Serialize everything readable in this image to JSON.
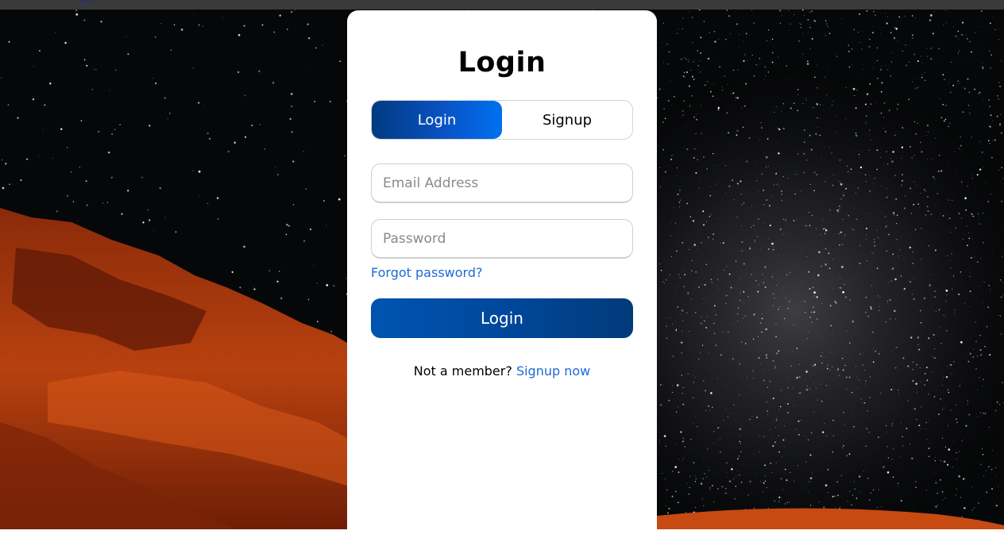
{
  "card": {
    "title": "Login",
    "tabs": [
      {
        "label": "Login",
        "active": true
      },
      {
        "label": "Signup",
        "active": false
      }
    ],
    "email": {
      "placeholder": "Email Address",
      "value": ""
    },
    "password": {
      "placeholder": "Password",
      "value": ""
    },
    "forgot_label": "Forgot password?",
    "submit_label": "Login",
    "member_text": "Not a member?",
    "signup_link": "Signup now"
  },
  "colors": {
    "accent": "#0a52c4",
    "link": "#1c6ad6",
    "rock": "#c4440f",
    "sky": "#050607"
  }
}
